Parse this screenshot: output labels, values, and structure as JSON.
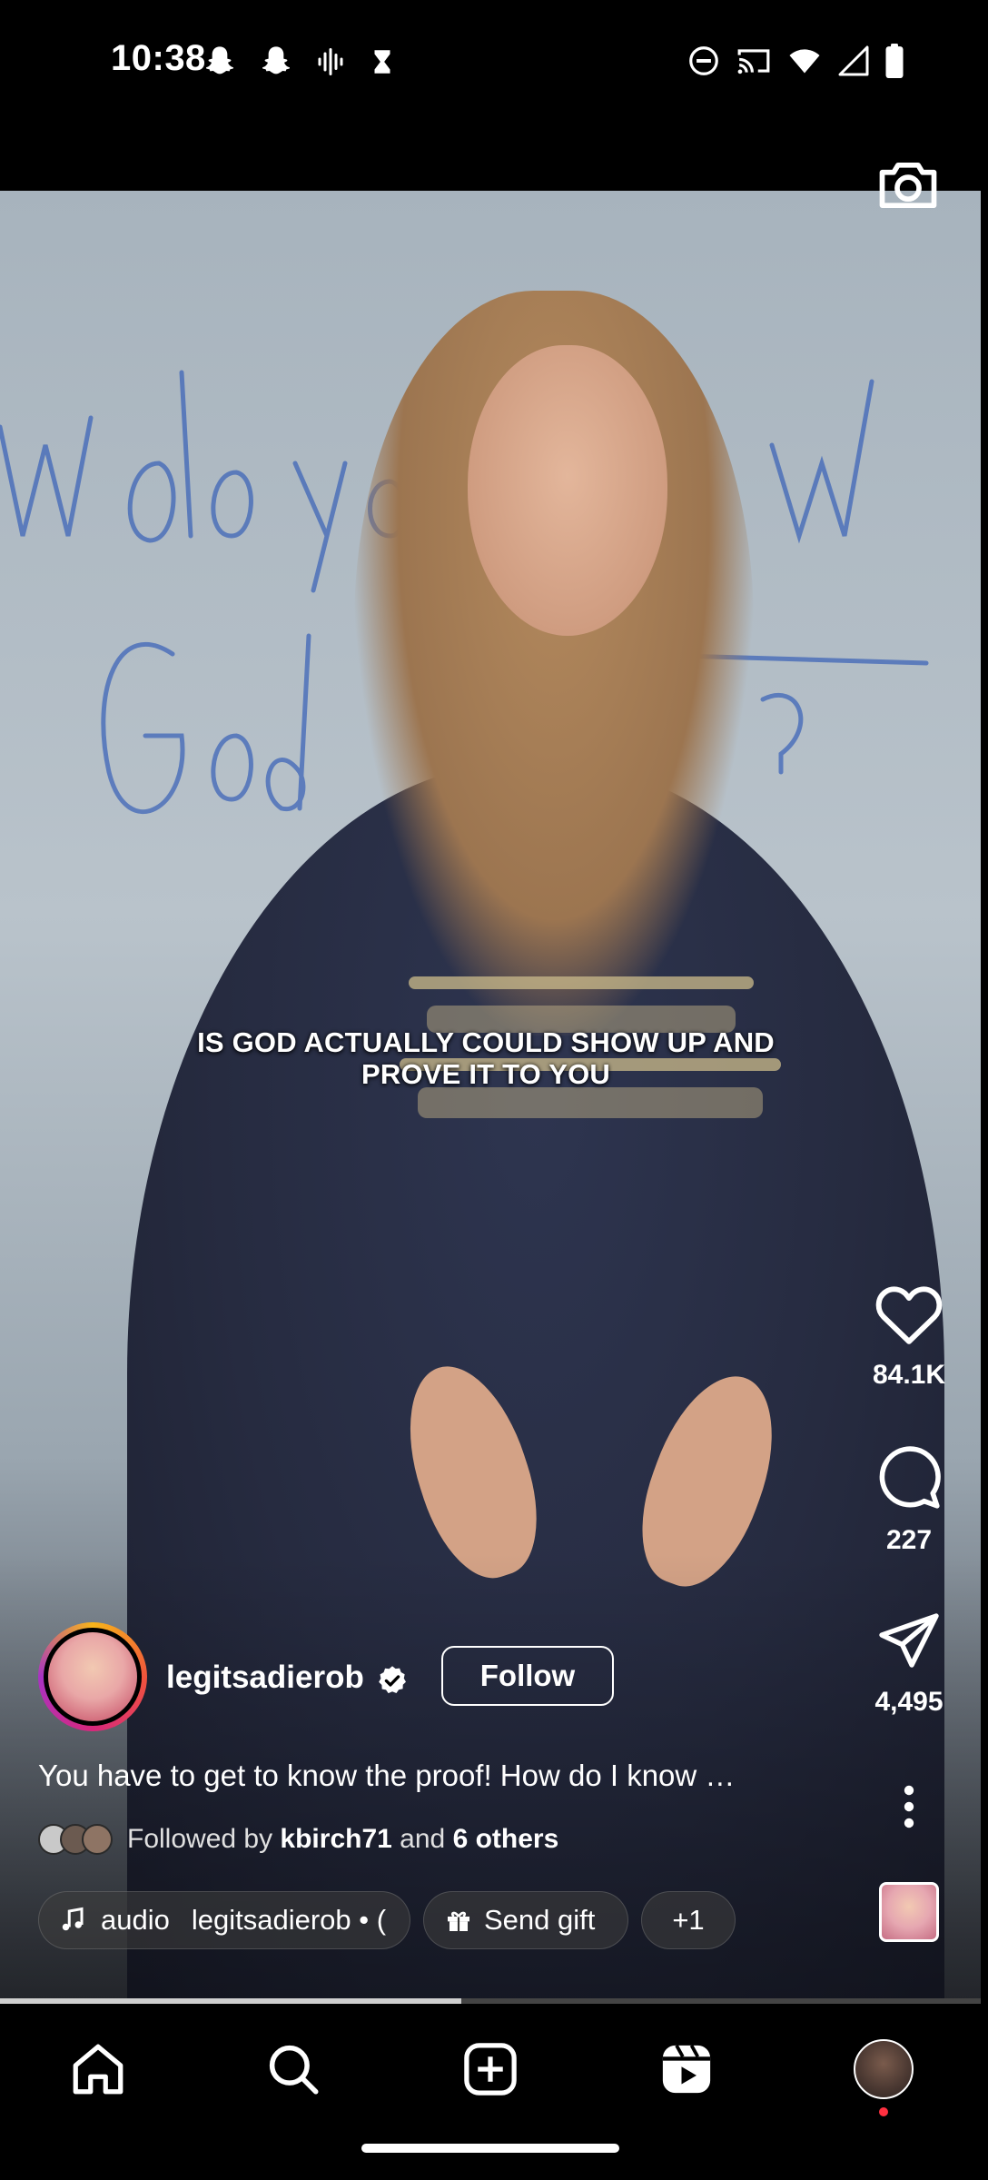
{
  "status_bar": {
    "time": "10:38"
  },
  "video": {
    "caption": "IS GOD ACTUALLY COULD SHOW UP AND PROVE IT TO YOU",
    "progress_fraction": 0.47
  },
  "actions": {
    "likes": "84.1K",
    "comments": "227",
    "shares": "4,495"
  },
  "author": {
    "username": "legitsadierob",
    "follow_label": "Follow"
  },
  "post": {
    "description": "You have to get to know the proof! How do I know …",
    "followed_by_prefix": "Followed by",
    "followed_by_user": "kbirch71",
    "followed_by_and": "and",
    "followed_by_others": "6 others"
  },
  "chips": {
    "audio_label": "audio",
    "audio_user": "legitsadierob • (",
    "gift_label": "Send gift",
    "more_label": "+1"
  },
  "icons": {
    "camera": "camera-icon",
    "like": "heart-icon",
    "comment": "comment-icon",
    "share": "send-icon",
    "more": "more-vertical-icon",
    "home": "home-icon",
    "search": "search-icon",
    "create": "add-square-icon",
    "reels": "reels-icon"
  },
  "colors": {
    "notification_dot": "#ff3040",
    "verified_badge": "#ffffff"
  }
}
